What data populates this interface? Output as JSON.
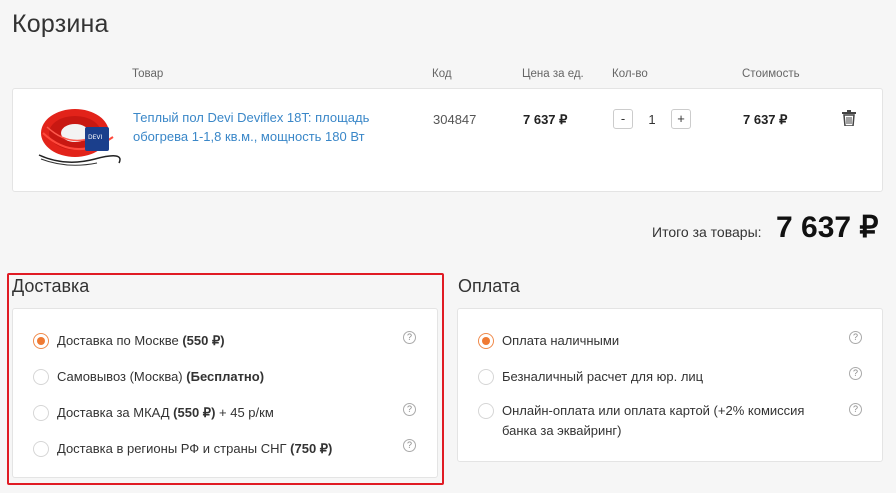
{
  "page": {
    "title": "Корзина"
  },
  "cart": {
    "headers": {
      "product": "Товар",
      "code": "Код",
      "price": "Цена за ед.",
      "qty": "Кол-во",
      "total": "Стоимость"
    },
    "item": {
      "name": "Теплый пол Devi Deviflex 18T: площадь обогрева 1-1,8 кв.м., мощность 180 Вт",
      "code": "304847",
      "price": "7 637 ₽",
      "qty": "1",
      "total": "7 637 ₽",
      "minus": "-",
      "plus": "+"
    },
    "summary": {
      "label": "Итого за товары:",
      "value": "7 637 ₽"
    }
  },
  "delivery": {
    "title": "Доставка",
    "options": [
      {
        "text": "Доставка по Москве ",
        "bold": "(550 ₽)",
        "suffix": "",
        "selected": true
      },
      {
        "text": "Самовывоз (Москва) ",
        "bold": "(Бесплатно)",
        "suffix": "",
        "selected": false
      },
      {
        "text": "Доставка за МКАД ",
        "bold": "(550 ₽)",
        "suffix": " + 45 р/км",
        "selected": false
      },
      {
        "text": "Доставка в регионы РФ и страны СНГ ",
        "bold": "(750 ₽)",
        "suffix": "",
        "selected": false
      }
    ]
  },
  "payment": {
    "title": "Оплата",
    "options": [
      {
        "text": "Оплата наличными",
        "selected": true
      },
      {
        "text": "Безналичный расчет для юр. лиц",
        "selected": false
      },
      {
        "text": "Онлайн-оплата или оплата картой (+2% комиссия банка за эквайринг)",
        "selected": false
      }
    ]
  },
  "icons": {
    "help": "?",
    "trash": "trash-icon"
  },
  "colors": {
    "link": "#3a87c8",
    "accent": "#ef7a33",
    "highlight": "#e01b24"
  }
}
